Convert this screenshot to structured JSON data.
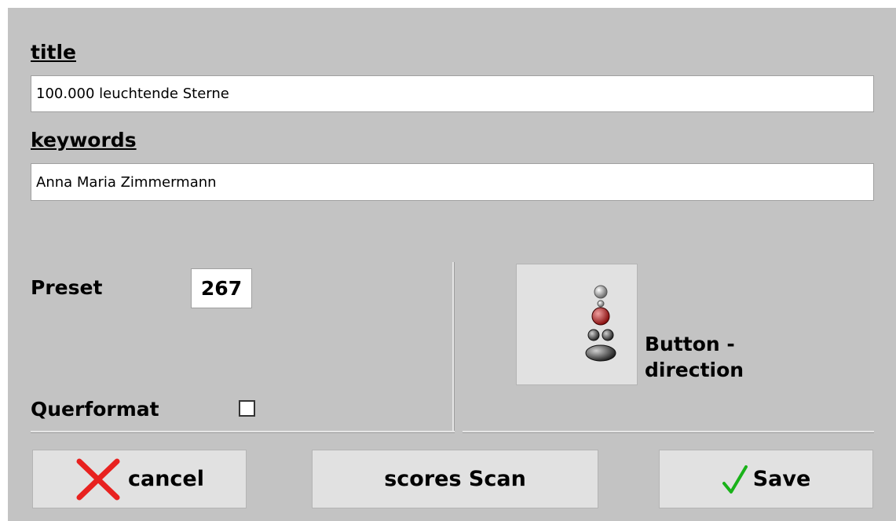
{
  "form": {
    "title_label": "title",
    "title_value": "100.000 leuchtende Sterne",
    "keywords_label": "keywords",
    "keywords_value": "Anna Maria Zimmermann"
  },
  "options": {
    "preset_label": "Preset",
    "preset_value": "267",
    "landscape_label": "Querformat",
    "landscape_checked": false
  },
  "direction_button": {
    "label": "Button - direction",
    "icon": "remote-buttons-icon"
  },
  "buttons": {
    "cancel_label": "cancel",
    "scan_label": "scores Scan",
    "save_label": "Save"
  },
  "colors": {
    "panel_bg": "#c3c3c3",
    "cancel_icon": "#e8211f",
    "save_icon": "#19b219"
  }
}
